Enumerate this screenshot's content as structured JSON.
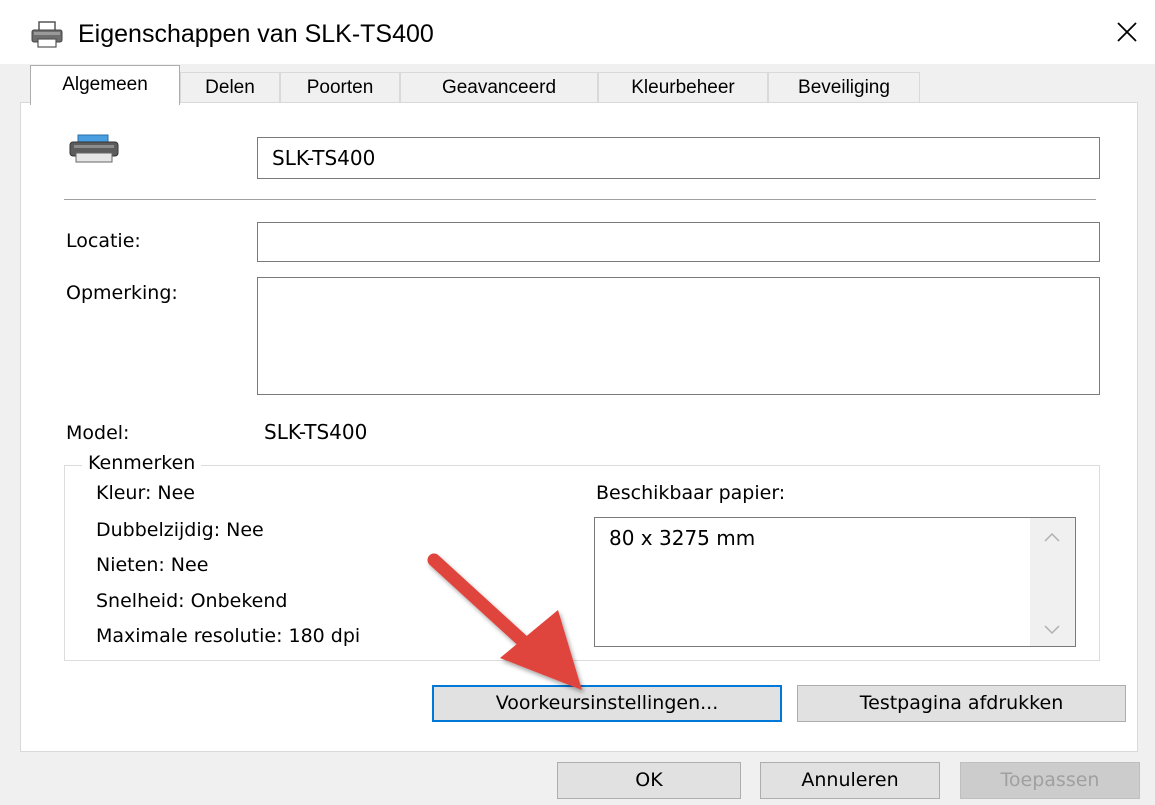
{
  "window": {
    "title": "Eigenschappen van SLK-TS400",
    "icon": "printer-icon",
    "close_icon": "close-icon"
  },
  "tabs": [
    {
      "label": "Algemeen",
      "active": true
    },
    {
      "label": "Delen",
      "active": false
    },
    {
      "label": "Poorten",
      "active": false
    },
    {
      "label": "Geavanceerd",
      "active": false
    },
    {
      "label": "Kleurbeheer",
      "active": false
    },
    {
      "label": "Beveiliging",
      "active": false
    }
  ],
  "general": {
    "printer_name": "SLK-TS400",
    "location_label": "Locatie:",
    "location_value": "",
    "comment_label": "Opmerking:",
    "comment_value": "",
    "model_label": "Model:",
    "model_value": "SLK-TS400"
  },
  "features": {
    "legend": "Kenmerken",
    "color": "Kleur: Nee",
    "duplex": "Dubbelzijdig: Nee",
    "staple": "Nieten: Nee",
    "speed": "Snelheid: Onbekend",
    "max_resolution": "Maximale resolutie: 180 dpi",
    "paper_label": "Beschikbaar papier:",
    "paper_items": [
      "80 x 3275 mm"
    ]
  },
  "buttons": {
    "preferences": "Voorkeursinstellingen...",
    "test_page": "Testpagina afdrukken",
    "ok": "OK",
    "cancel": "Annuleren",
    "apply": "Toepassen"
  },
  "colors": {
    "focus_border": "#0078d7",
    "annotation_arrow": "#e0443d"
  }
}
